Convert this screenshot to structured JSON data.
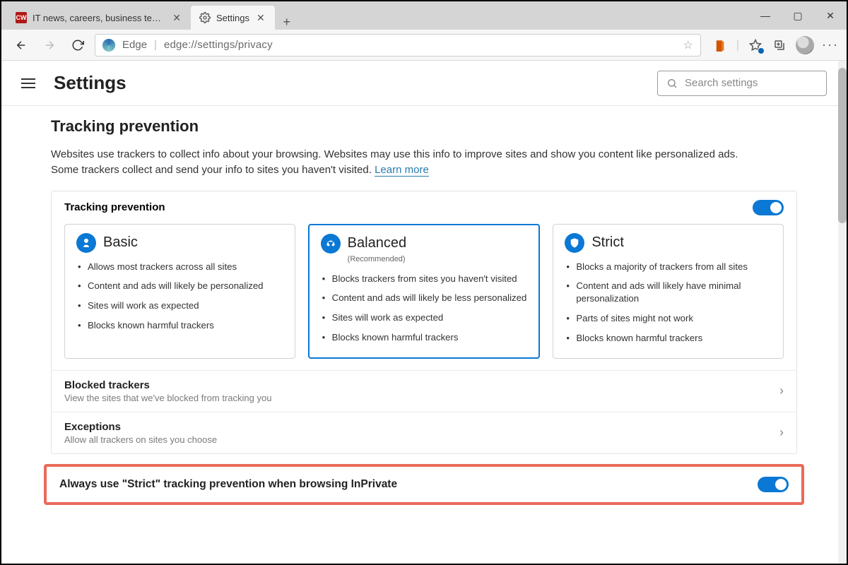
{
  "window": {
    "tabs": [
      {
        "title": "IT news, careers, business technology",
        "favicon_text": "CW",
        "favicon_bg": "#b01818",
        "favicon_fg": "#ffffff",
        "active": false
      },
      {
        "title": "Settings",
        "favicon_text": "",
        "active": true
      }
    ],
    "controls": {
      "minimize": "—",
      "maximize": "▢",
      "close": "✕"
    }
  },
  "toolbar": {
    "browser_label": "Edge",
    "url": "edge://settings/privacy"
  },
  "header": {
    "title": "Settings",
    "search_placeholder": "Search settings"
  },
  "tracking": {
    "heading": "Tracking prevention",
    "description": "Websites use trackers to collect info about your browsing. Websites may use this info to improve sites and show you content like personalized ads. Some trackers collect and send your info to sites you haven't visited. ",
    "learn_more": "Learn more",
    "toggle_label": "Tracking prevention",
    "toggle_on": true,
    "levels": [
      {
        "name": "Basic",
        "icon": "basic",
        "recommended": false,
        "bullets": [
          "Allows most trackers across all sites",
          "Content and ads will likely be personalized",
          "Sites will work as expected",
          "Blocks known harmful trackers"
        ]
      },
      {
        "name": "Balanced",
        "icon": "balanced",
        "recommended": true,
        "recommended_label": "(Recommended)",
        "bullets": [
          "Blocks trackers from sites you haven't visited",
          "Content and ads will likely be less personalized",
          "Sites will work as expected",
          "Blocks known harmful trackers"
        ]
      },
      {
        "name": "Strict",
        "icon": "strict",
        "recommended": false,
        "bullets": [
          "Blocks a majority of trackers from all sites",
          "Content and ads will likely have minimal personalization",
          "Parts of sites might not work",
          "Blocks known harmful trackers"
        ]
      }
    ],
    "rows": [
      {
        "title": "Blocked trackers",
        "sub": "View the sites that we've blocked from tracking you"
      },
      {
        "title": "Exceptions",
        "sub": "Allow all trackers on sites you choose"
      }
    ],
    "strict_inprivate": {
      "label": "Always use \"Strict\" tracking prevention when browsing InPrivate",
      "on": true
    }
  }
}
